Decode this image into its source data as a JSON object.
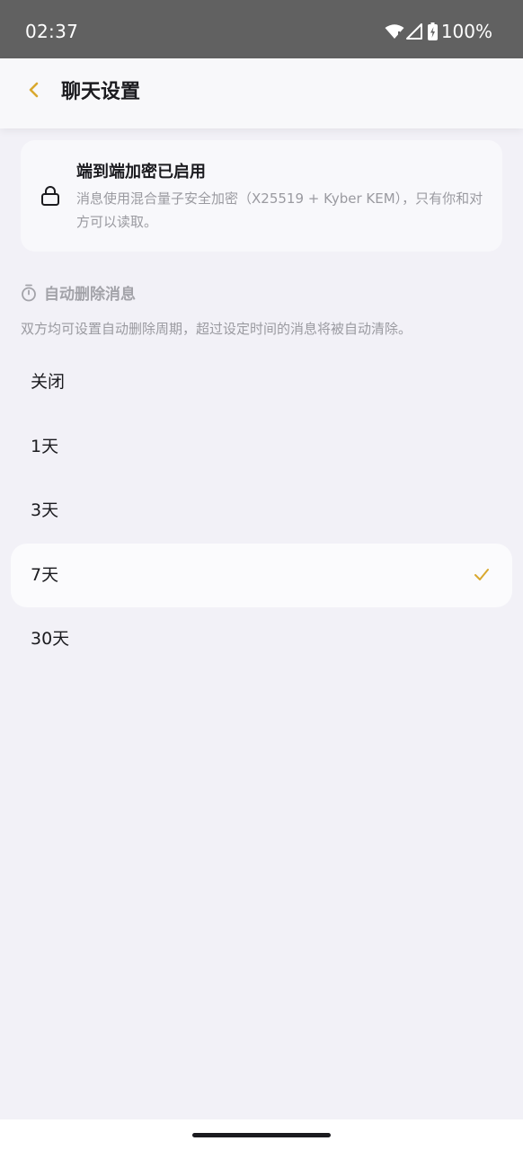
{
  "status_bar": {
    "time": "02:37",
    "battery": "100%",
    "icons": [
      "wifi-icon",
      "signal-icon",
      "battery-icon"
    ]
  },
  "header": {
    "back_icon": "chevron-left-icon",
    "title": "聊天设置"
  },
  "encryption": {
    "icon": "lock-icon",
    "title": "端到端加密已启用",
    "description": "消息使用混合量子安全加密（X25519 + Kyber KEM），只有你和对方可以读取。"
  },
  "auto_delete": {
    "icon": "timer-icon",
    "title": "自动删除消息",
    "description": "双方均可设置自动删除周期，超过设定时间的消息将被自动清除。",
    "options": [
      {
        "label": "关闭",
        "selected": false
      },
      {
        "label": "1天",
        "selected": false
      },
      {
        "label": "3天",
        "selected": false
      },
      {
        "label": "7天",
        "selected": true
      },
      {
        "label": "30天",
        "selected": false
      }
    ],
    "selected_icon": "check-icon"
  },
  "colors": {
    "accent": "#d9a82e",
    "background": "#f2f1f7",
    "card": "#f8f8fb",
    "status_bar": "#616161",
    "text_primary": "#1b1b1f",
    "text_secondary": "#9a9aa0"
  }
}
